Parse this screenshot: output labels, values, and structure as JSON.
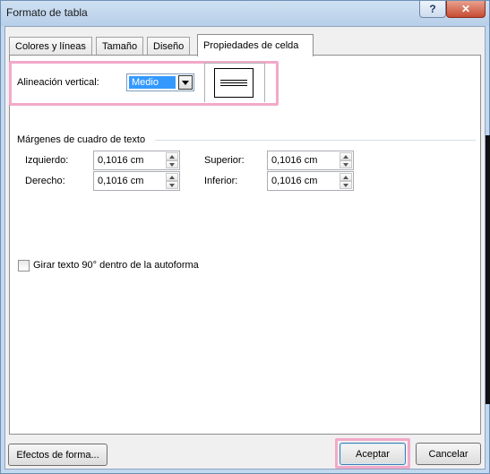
{
  "window": {
    "title": "Formato de tabla",
    "help": "?",
    "close": "✕"
  },
  "tabs": [
    {
      "label": "Colores y líneas"
    },
    {
      "label": "Tamaño"
    },
    {
      "label": "Diseño"
    },
    {
      "label": "Propiedades de celda",
      "active": true
    }
  ],
  "alignment": {
    "label": "Alineación vertical:",
    "value": "Medio"
  },
  "margins": {
    "group_label": "Márgenes de cuadro de texto",
    "left": {
      "label": "Izquierdo:",
      "value": "0,1016 cm"
    },
    "right": {
      "label": "Derecho:",
      "value": "0,1016 cm"
    },
    "top": {
      "label": "Superior:",
      "value": "0,1016 cm"
    },
    "bottom": {
      "label": "Inferior:",
      "value": "0,1016 cm"
    }
  },
  "rotate": {
    "label": "Girar texto 90° dentro de la autoforma",
    "checked": false
  },
  "buttons": {
    "effects": "Efectos de forma...",
    "ok": "Aceptar",
    "cancel": "Cancelar"
  },
  "colors": {
    "highlight": "#f2a9c9",
    "selection": "#3399ff",
    "close": "#c74b33"
  }
}
